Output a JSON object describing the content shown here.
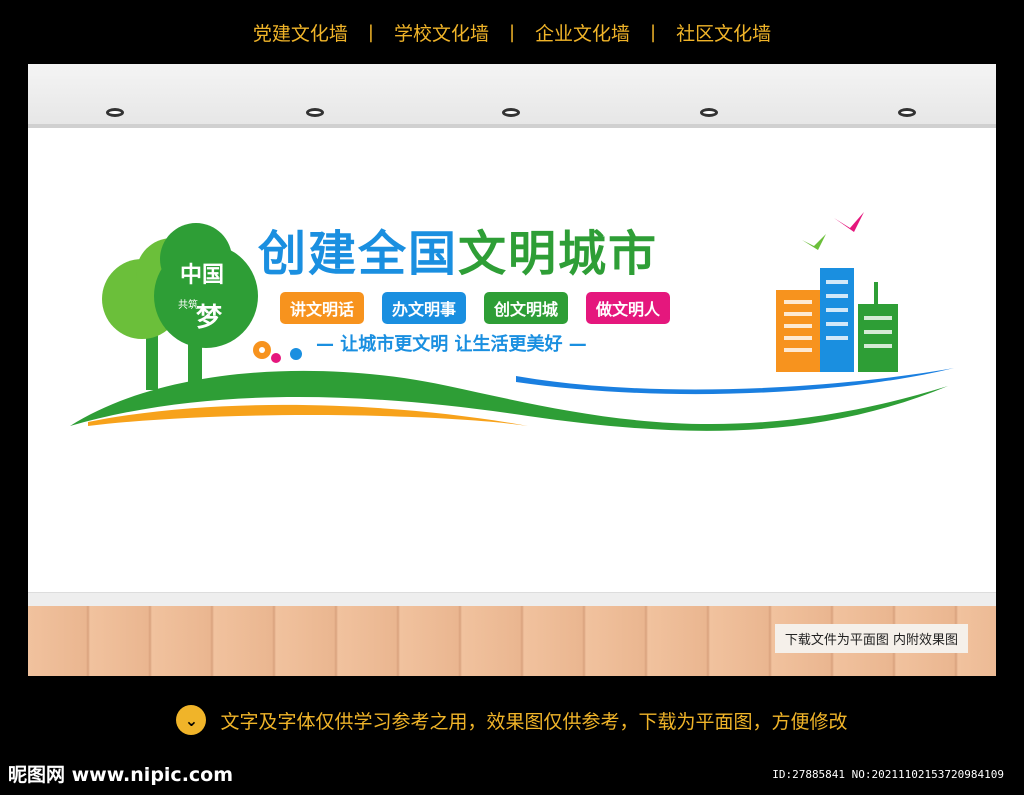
{
  "nav": {
    "items": [
      "党建文化墙",
      "学校文化墙",
      "企业文化墙",
      "社区文化墙"
    ],
    "separator": "|"
  },
  "mural": {
    "title_part1": "创建全国",
    "title_part2": "文明城市",
    "badge_top": "中国",
    "badge_bottom": "梦",
    "badge_side": "共筑",
    "tags": [
      {
        "label": "讲文明话",
        "color": "#f7931e"
      },
      {
        "label": "办文明事",
        "color": "#1a8fe0"
      },
      {
        "label": "创文明城",
        "color": "#2e9e36"
      },
      {
        "label": "做文明人",
        "color": "#e5177d"
      }
    ],
    "slogan": "— 让城市更文明  让生活更美好 —"
  },
  "floor_note": "下载文件为平面图  内附效果图",
  "footer": {
    "chevron_icon": "chevron-down-icon",
    "text": "文字及字体仅供学习参考之用，效果图仅供参考，下载为平面图，方便修改"
  },
  "brand": "昵图网 www.nipic.com",
  "id_text": "ID:27885841 NO:20211102153720984109",
  "colors": {
    "accent": "#f0b429",
    "blue": "#1a8fe0",
    "green": "#2e9e36",
    "orange": "#f7931e",
    "pink": "#e5177d"
  }
}
